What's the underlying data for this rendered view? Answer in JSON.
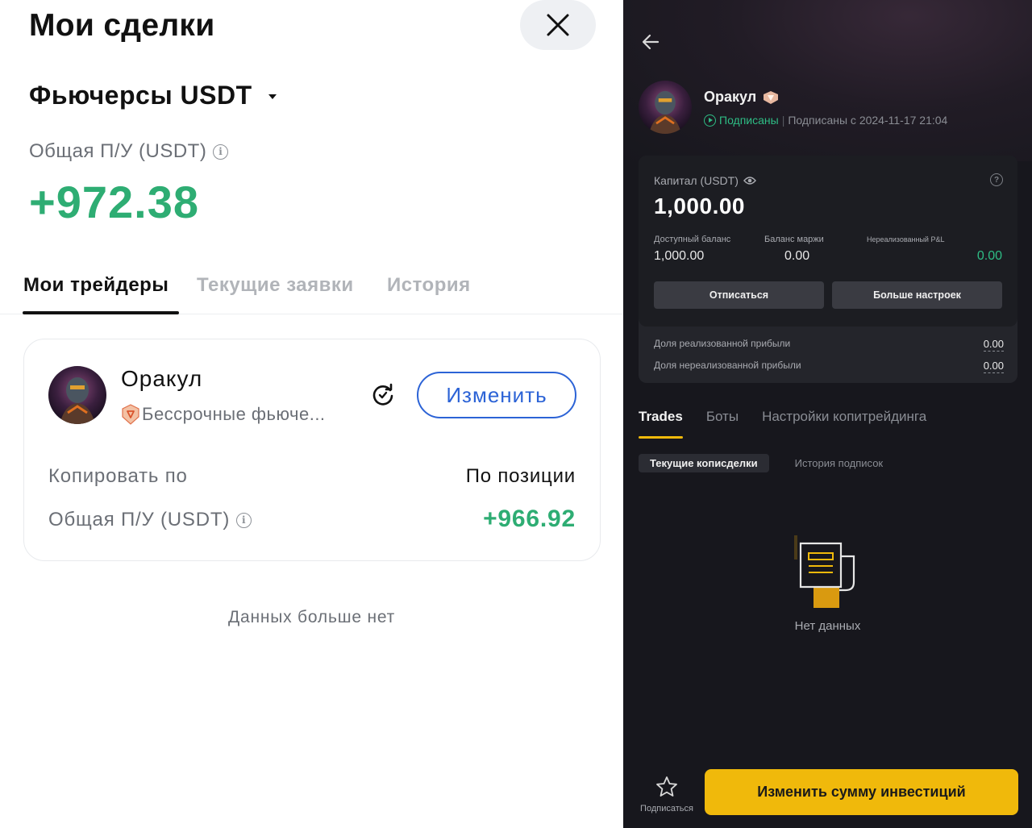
{
  "left": {
    "title": "Мои сделки",
    "market_selector": "Фьючерсы USDT",
    "pnl_label": "Общая П/У (USDT)",
    "pnl_value": "+972.38",
    "tabs": [
      {
        "label": "Мои трейдеры",
        "active": true
      },
      {
        "label": "Текущие заявки",
        "active": false
      },
      {
        "label": "История",
        "active": false
      }
    ],
    "trader_card": {
      "name": "Оракул",
      "type": "Бессрочные фьюче...",
      "edit_label": "Изменить",
      "copy_by_label": "Копировать по",
      "copy_by_value": "По позиции",
      "pnl_label": "Общая П/У (USDT)",
      "pnl_value": "+966.92"
    },
    "no_more": "Данных больше нет",
    "colors": {
      "green": "#2ead73",
      "blue": "#2c63d6"
    }
  },
  "right": {
    "trader_name": "Оракул",
    "subscribed_label": "Подписаны",
    "subscribed_since": "Подписаны с 2024-11-17 21:04",
    "capital_label": "Капитал (USDT)",
    "capital_value": "1,000.00",
    "available_label": "Доступный баланс",
    "available_value": "1,000.00",
    "margin_label": "Баланс маржи",
    "margin_value": "0.00",
    "unrealized_label": "Нереализованный P&L",
    "unrealized_value": "0.00",
    "unsubscribe_label": "Отписаться",
    "more_settings_label": "Больше настроек",
    "realized_share_label": "Доля реализованной прибыли",
    "realized_share_value": "0.00",
    "unrealized_share_label": "Доля нереализованной прибыли",
    "unrealized_share_value": "0.00",
    "tabs": [
      {
        "label": "Trades",
        "active": true
      },
      {
        "label": "Боты",
        "active": false
      },
      {
        "label": "Настройки копитрейдинга",
        "active": false
      }
    ],
    "subtabs": [
      {
        "label": "Текущие копиcделки",
        "active": true
      },
      {
        "label": "История подписок",
        "active": false
      }
    ],
    "empty_text": "Нет данных",
    "subscribe_label": "Подписаться",
    "main_button_label": "Изменить сумму инвестиций",
    "colors": {
      "accent": "#f0b90b",
      "green": "#2ebd85",
      "background": "#17171d"
    }
  }
}
